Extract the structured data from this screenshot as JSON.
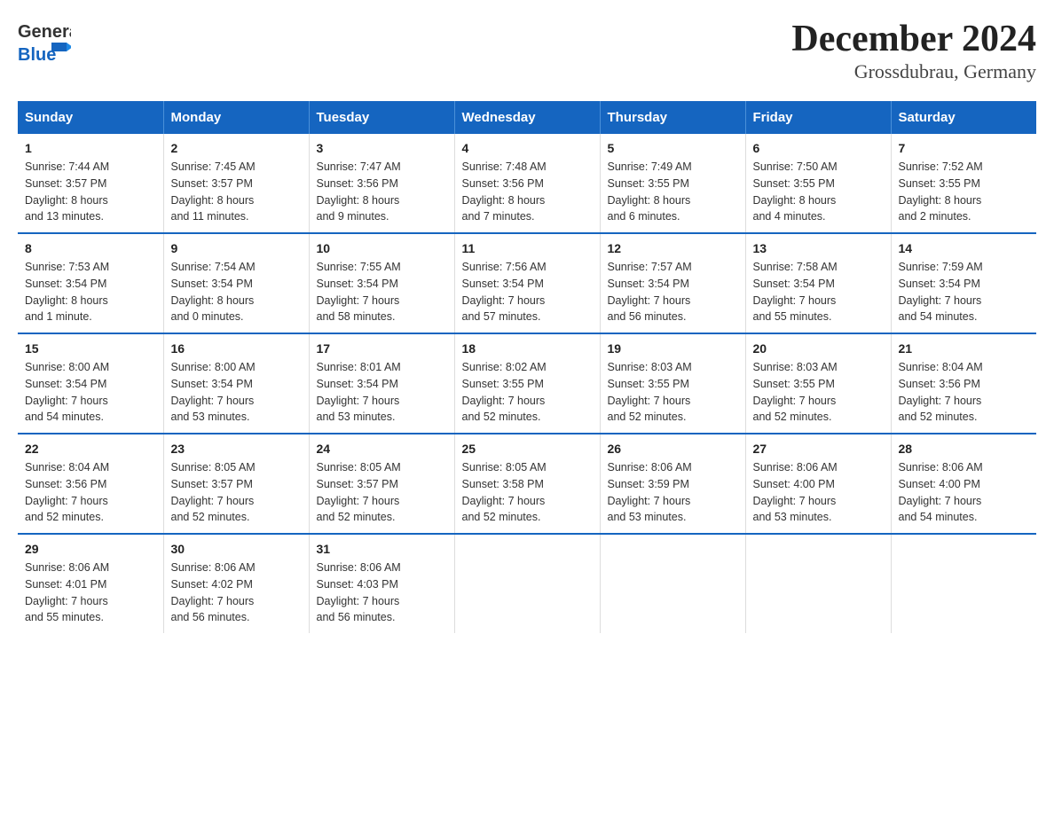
{
  "header": {
    "title": "December 2024",
    "subtitle": "Grossdubrau, Germany"
  },
  "days_of_week": [
    "Sunday",
    "Monday",
    "Tuesday",
    "Wednesday",
    "Thursday",
    "Friday",
    "Saturday"
  ],
  "weeks": [
    [
      {
        "day": "1",
        "info": "Sunrise: 7:44 AM\nSunset: 3:57 PM\nDaylight: 8 hours\nand 13 minutes."
      },
      {
        "day": "2",
        "info": "Sunrise: 7:45 AM\nSunset: 3:57 PM\nDaylight: 8 hours\nand 11 minutes."
      },
      {
        "day": "3",
        "info": "Sunrise: 7:47 AM\nSunset: 3:56 PM\nDaylight: 8 hours\nand 9 minutes."
      },
      {
        "day": "4",
        "info": "Sunrise: 7:48 AM\nSunset: 3:56 PM\nDaylight: 8 hours\nand 7 minutes."
      },
      {
        "day": "5",
        "info": "Sunrise: 7:49 AM\nSunset: 3:55 PM\nDaylight: 8 hours\nand 6 minutes."
      },
      {
        "day": "6",
        "info": "Sunrise: 7:50 AM\nSunset: 3:55 PM\nDaylight: 8 hours\nand 4 minutes."
      },
      {
        "day": "7",
        "info": "Sunrise: 7:52 AM\nSunset: 3:55 PM\nDaylight: 8 hours\nand 2 minutes."
      }
    ],
    [
      {
        "day": "8",
        "info": "Sunrise: 7:53 AM\nSunset: 3:54 PM\nDaylight: 8 hours\nand 1 minute."
      },
      {
        "day": "9",
        "info": "Sunrise: 7:54 AM\nSunset: 3:54 PM\nDaylight: 8 hours\nand 0 minutes."
      },
      {
        "day": "10",
        "info": "Sunrise: 7:55 AM\nSunset: 3:54 PM\nDaylight: 7 hours\nand 58 minutes."
      },
      {
        "day": "11",
        "info": "Sunrise: 7:56 AM\nSunset: 3:54 PM\nDaylight: 7 hours\nand 57 minutes."
      },
      {
        "day": "12",
        "info": "Sunrise: 7:57 AM\nSunset: 3:54 PM\nDaylight: 7 hours\nand 56 minutes."
      },
      {
        "day": "13",
        "info": "Sunrise: 7:58 AM\nSunset: 3:54 PM\nDaylight: 7 hours\nand 55 minutes."
      },
      {
        "day": "14",
        "info": "Sunrise: 7:59 AM\nSunset: 3:54 PM\nDaylight: 7 hours\nand 54 minutes."
      }
    ],
    [
      {
        "day": "15",
        "info": "Sunrise: 8:00 AM\nSunset: 3:54 PM\nDaylight: 7 hours\nand 54 minutes."
      },
      {
        "day": "16",
        "info": "Sunrise: 8:00 AM\nSunset: 3:54 PM\nDaylight: 7 hours\nand 53 minutes."
      },
      {
        "day": "17",
        "info": "Sunrise: 8:01 AM\nSunset: 3:54 PM\nDaylight: 7 hours\nand 53 minutes."
      },
      {
        "day": "18",
        "info": "Sunrise: 8:02 AM\nSunset: 3:55 PM\nDaylight: 7 hours\nand 52 minutes."
      },
      {
        "day": "19",
        "info": "Sunrise: 8:03 AM\nSunset: 3:55 PM\nDaylight: 7 hours\nand 52 minutes."
      },
      {
        "day": "20",
        "info": "Sunrise: 8:03 AM\nSunset: 3:55 PM\nDaylight: 7 hours\nand 52 minutes."
      },
      {
        "day": "21",
        "info": "Sunrise: 8:04 AM\nSunset: 3:56 PM\nDaylight: 7 hours\nand 52 minutes."
      }
    ],
    [
      {
        "day": "22",
        "info": "Sunrise: 8:04 AM\nSunset: 3:56 PM\nDaylight: 7 hours\nand 52 minutes."
      },
      {
        "day": "23",
        "info": "Sunrise: 8:05 AM\nSunset: 3:57 PM\nDaylight: 7 hours\nand 52 minutes."
      },
      {
        "day": "24",
        "info": "Sunrise: 8:05 AM\nSunset: 3:57 PM\nDaylight: 7 hours\nand 52 minutes."
      },
      {
        "day": "25",
        "info": "Sunrise: 8:05 AM\nSunset: 3:58 PM\nDaylight: 7 hours\nand 52 minutes."
      },
      {
        "day": "26",
        "info": "Sunrise: 8:06 AM\nSunset: 3:59 PM\nDaylight: 7 hours\nand 53 minutes."
      },
      {
        "day": "27",
        "info": "Sunrise: 8:06 AM\nSunset: 4:00 PM\nDaylight: 7 hours\nand 53 minutes."
      },
      {
        "day": "28",
        "info": "Sunrise: 8:06 AM\nSunset: 4:00 PM\nDaylight: 7 hours\nand 54 minutes."
      }
    ],
    [
      {
        "day": "29",
        "info": "Sunrise: 8:06 AM\nSunset: 4:01 PM\nDaylight: 7 hours\nand 55 minutes."
      },
      {
        "day": "30",
        "info": "Sunrise: 8:06 AM\nSunset: 4:02 PM\nDaylight: 7 hours\nand 56 minutes."
      },
      {
        "day": "31",
        "info": "Sunrise: 8:06 AM\nSunset: 4:03 PM\nDaylight: 7 hours\nand 56 minutes."
      },
      {
        "day": "",
        "info": ""
      },
      {
        "day": "",
        "info": ""
      },
      {
        "day": "",
        "info": ""
      },
      {
        "day": "",
        "info": ""
      }
    ]
  ]
}
